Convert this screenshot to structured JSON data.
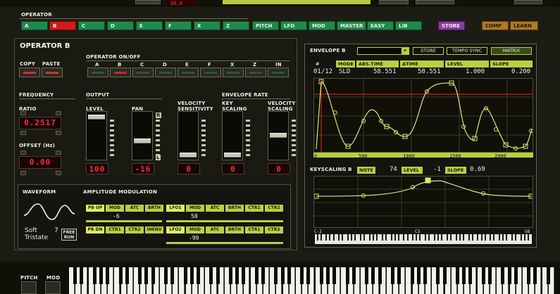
{
  "top": {
    "digits": "88.8",
    "lcd_text": ""
  },
  "operator_row": {
    "section_label": "OPERATOR",
    "operators": [
      "A",
      "B",
      "C",
      "D",
      "E",
      "F",
      "X",
      "Z"
    ],
    "selected": "B",
    "nav": [
      "PITCH",
      "LFO",
      "MOD",
      "MASTER",
      "EASY",
      "LIB"
    ],
    "store": "STORE",
    "comp": "COMP",
    "learn": "LEARN"
  },
  "operator_panel": {
    "title": "OPERATOR B",
    "copy": "COPY",
    "paste": "PASTE",
    "onoff_label": "OPERATOR ON/OFF",
    "onoff_ops": [
      "A",
      "B",
      "C",
      "D",
      "E",
      "F",
      "X",
      "Z",
      "IN"
    ],
    "frequency_label": "FREQUENCY",
    "ratio_label": "RATIO",
    "ratio_value": "0.2517",
    "offset_label": "OFFSET (Hz)",
    "offset_value": "0.00",
    "output_label": "OUTPUT",
    "level_label": "LEVEL",
    "level_value": "100",
    "pan_label": "PAN",
    "pan_value": "-16",
    "pan_r": "R",
    "pan_l": "L",
    "vel_sens_label": "VELOCITY SENSITIVITY",
    "vel_sens_value": "0",
    "env_rate_label": "ENVELOPE RATE",
    "key_scaling_label": "KEY SCALING",
    "key_scaling_value": "0",
    "vel_scaling_label": "VELOCITY SCALING",
    "vel_scaling_value": "0"
  },
  "envelope": {
    "title": "ENVELOPE B",
    "store": "STORE",
    "tempo_sync": "TEMPO SYNC",
    "matrix": "MATRIX",
    "headers": [
      "#",
      "MODE",
      "ABS.TIME",
      "ΔTIME",
      "LEVEL",
      "SLOPE"
    ],
    "row": {
      "num": "01/12",
      "mode": "SLD",
      "abs_time": "58.551",
      "delta_time": "58.551",
      "level": "1.000",
      "slope": "0.200"
    },
    "x_ticks": [
      "0",
      "500",
      "1000",
      "1500",
      "2000"
    ]
  },
  "keyscaling": {
    "title": "KEYSCALING B",
    "note_label": "NOTE",
    "note_value": "74",
    "level_label": "LEVEL",
    "level_value": "-1",
    "slope_label": "SLOPE",
    "slope_value": "0.69",
    "key_c2": "C-2",
    "key_c3": "C3",
    "key_g8": "G8"
  },
  "waveform": {
    "label": "WAVEFORM",
    "shape": "Soft",
    "shape_num": "7",
    "name": "Tristate",
    "free_run_1": "FREE",
    "free_run_2": "RUN"
  },
  "amp_mod": {
    "label": "AMPLITUDE MODULATION",
    "row1_left": [
      "PB UP",
      "MOD",
      "ATC",
      "BRTH"
    ],
    "row1_right": [
      "LFO1",
      "MOD",
      "ATC",
      "BRTH",
      "CTR1",
      "CTR2"
    ],
    "row1_left_val": "-6",
    "row1_right_val": "58",
    "row2_left": [
      "PB DN",
      "CTR1",
      "CTR2",
      "INENV"
    ],
    "row2_right": [
      "LFO2",
      "MOD",
      "ATC",
      "BRTH",
      "CTR1",
      "CTR2"
    ],
    "row2_right_val": "-99"
  },
  "keyboard": {
    "pitch": "PITCH",
    "mod": "MOD"
  }
}
